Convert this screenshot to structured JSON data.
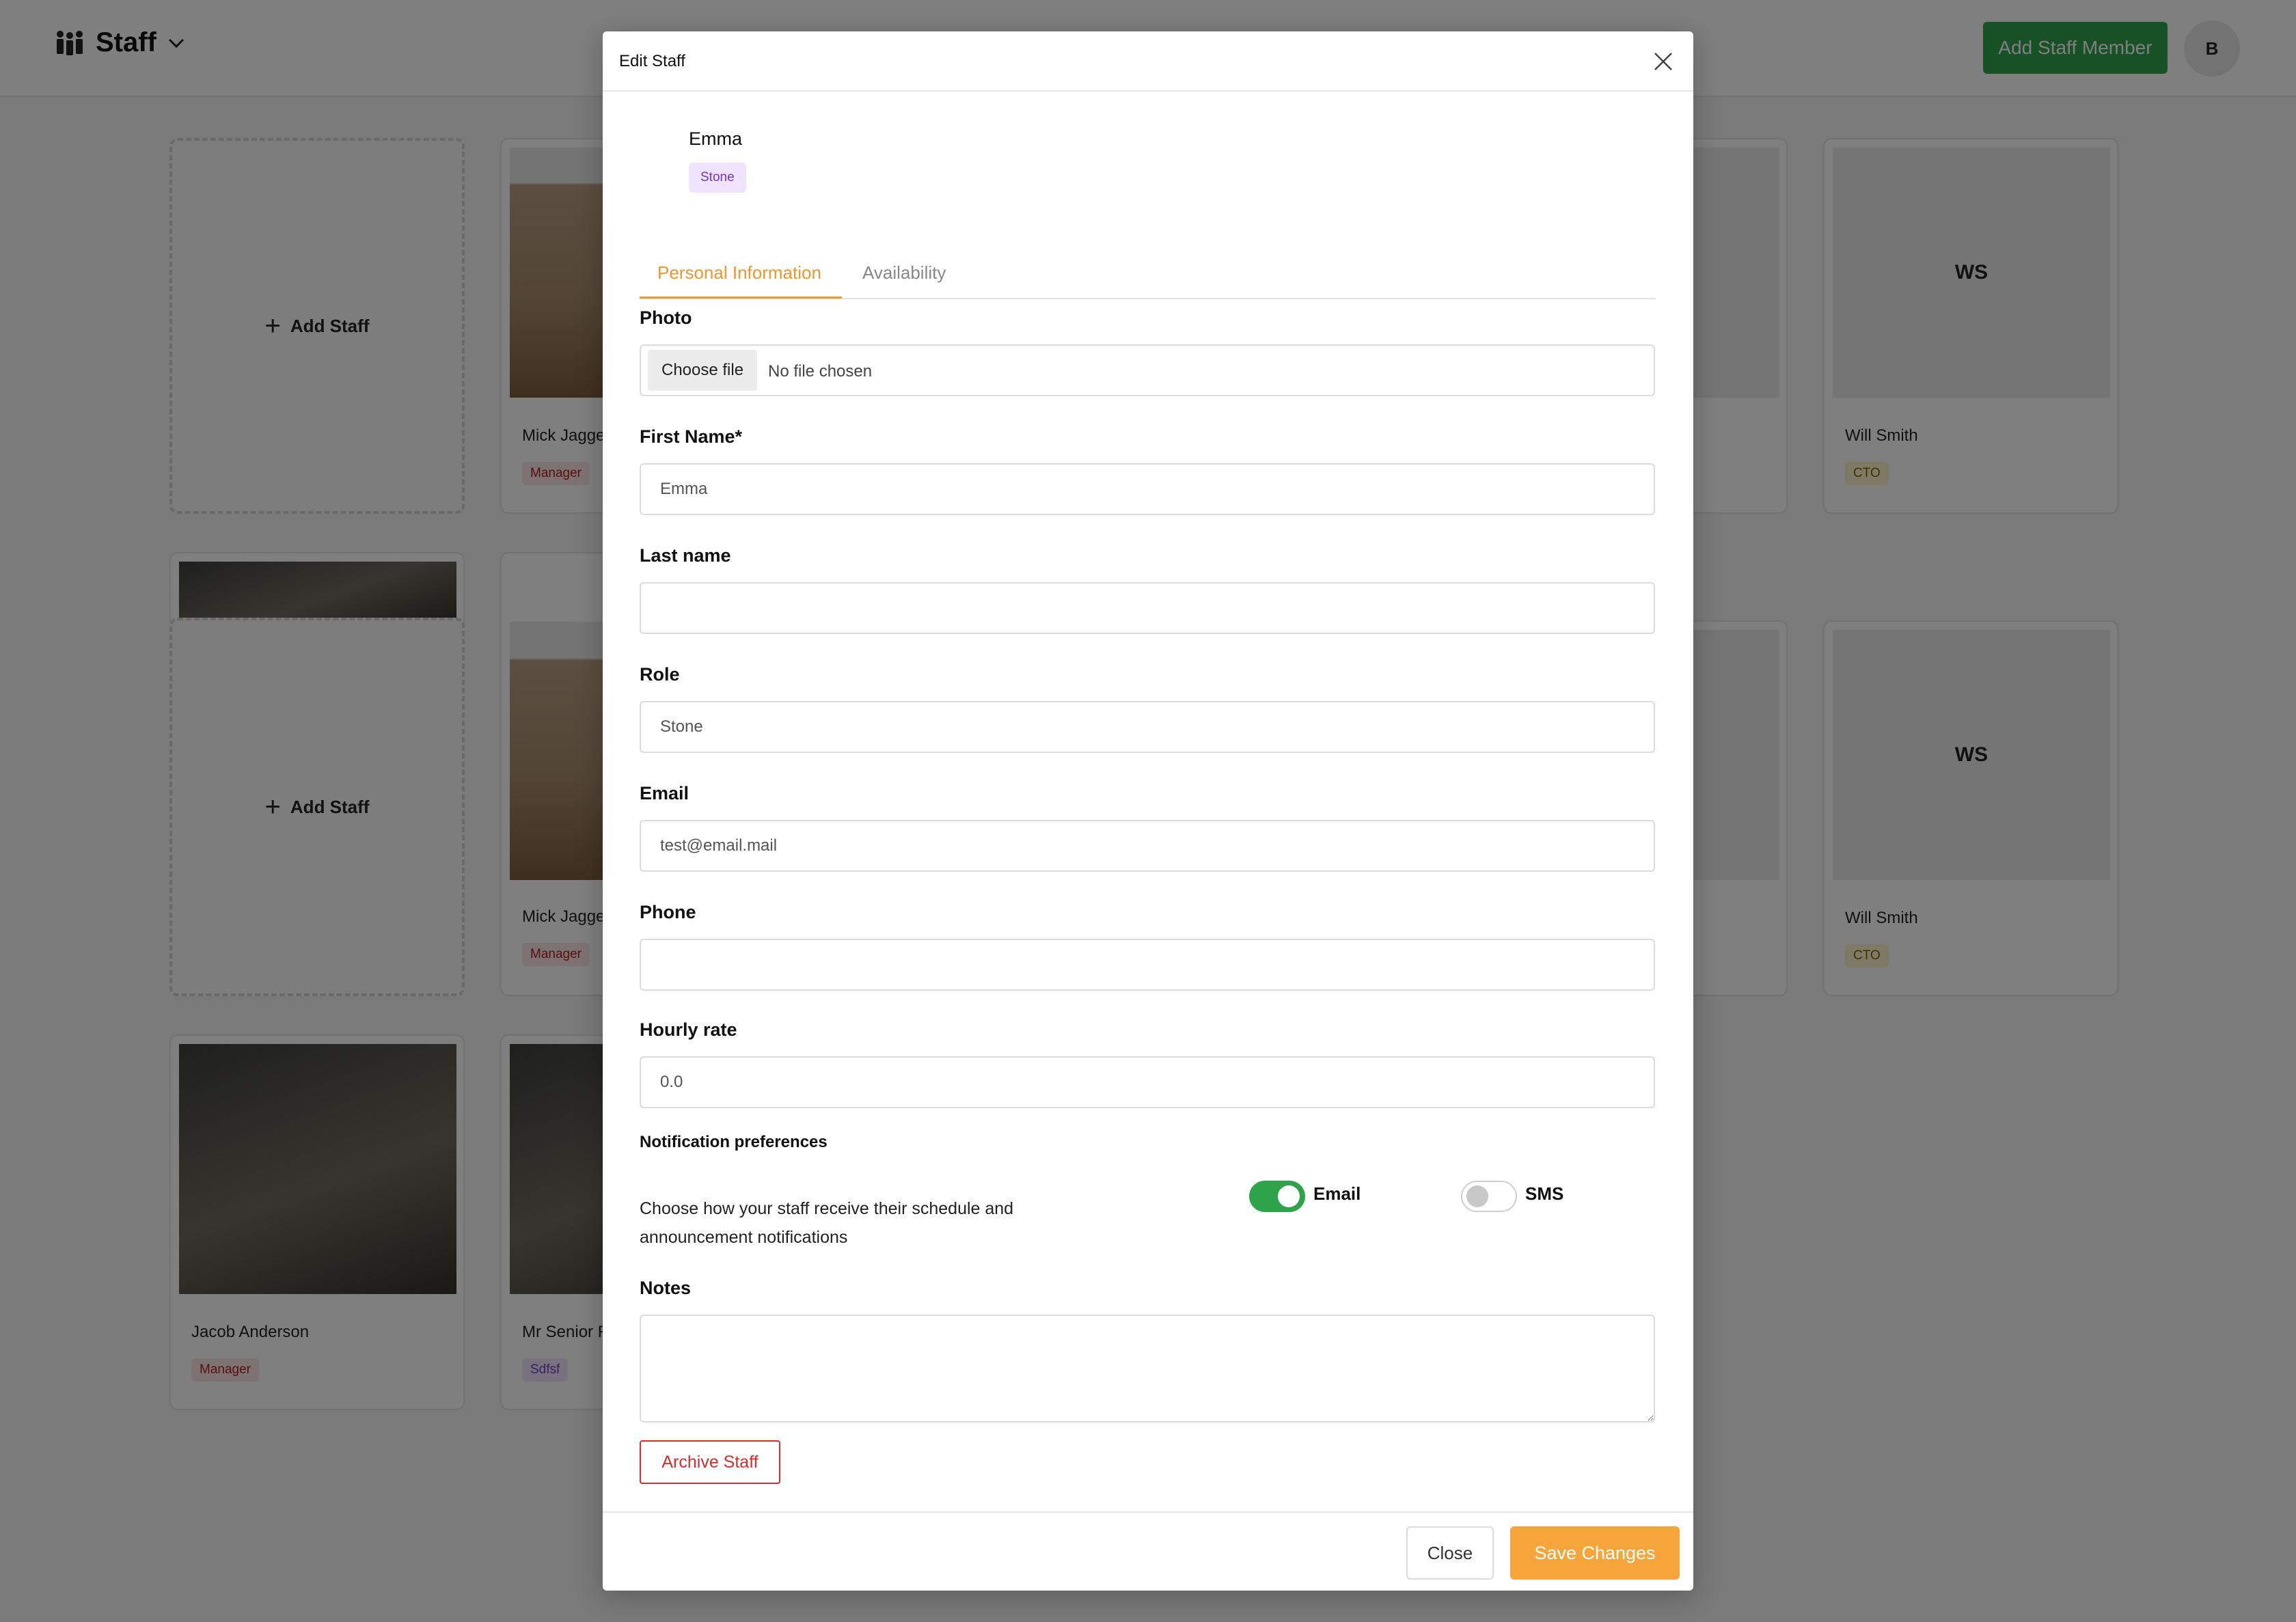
{
  "app": {
    "section_title": "Staff",
    "add_member_label": "Add Staff Member",
    "avatar_initial": "B"
  },
  "background_cards": {
    "add_label": "Add Staff",
    "staff": [
      {
        "name": "Mick Jagger",
        "role": "Manager"
      },
      {
        "name": "Will Smith",
        "role": "CTO",
        "initials": "WS"
      },
      {
        "name": "Mick Jagger",
        "role": "Manager"
      },
      {
        "name": "Will Smith",
        "role": "CTO",
        "initials": "WS"
      },
      {
        "name": "Jacob Anderson",
        "role": "Manager"
      },
      {
        "name": "Mr Senior R",
        "role": "Sdfsf"
      }
    ]
  },
  "modal": {
    "title": "Edit Staff",
    "staff_name": "Emma",
    "staff_role": "Stone",
    "tabs": [
      {
        "label": "Personal Information",
        "active": true
      },
      {
        "label": "Availability",
        "active": false
      }
    ],
    "fields": {
      "photo": {
        "label": "Photo",
        "button": "Choose file",
        "status": "No file chosen"
      },
      "first_name": {
        "label": "First Name*",
        "value": "Emma"
      },
      "last_name": {
        "label": "Last name",
        "value": ""
      },
      "role": {
        "label": "Role",
        "value": "Stone"
      },
      "email": {
        "label": "Email",
        "value": "test@email.mail"
      },
      "phone": {
        "label": "Phone",
        "value": ""
      },
      "hourly_rate": {
        "label": "Hourly rate",
        "value": "0.0"
      },
      "notes": {
        "label": "Notes",
        "value": ""
      }
    },
    "notifications": {
      "title": "Notification preferences",
      "description": "Choose how your staff receive their schedule and announcement notifications",
      "email": {
        "label": "Email",
        "enabled": true
      },
      "sms": {
        "label": "SMS",
        "enabled": false
      }
    },
    "archive_label": "Archive Staff",
    "close_label": "Close",
    "save_label": "Save Changes"
  },
  "colors": {
    "accent_orange": "#f6a53a",
    "brand_green": "#2fa34a",
    "danger_red": "#d92c2c"
  }
}
